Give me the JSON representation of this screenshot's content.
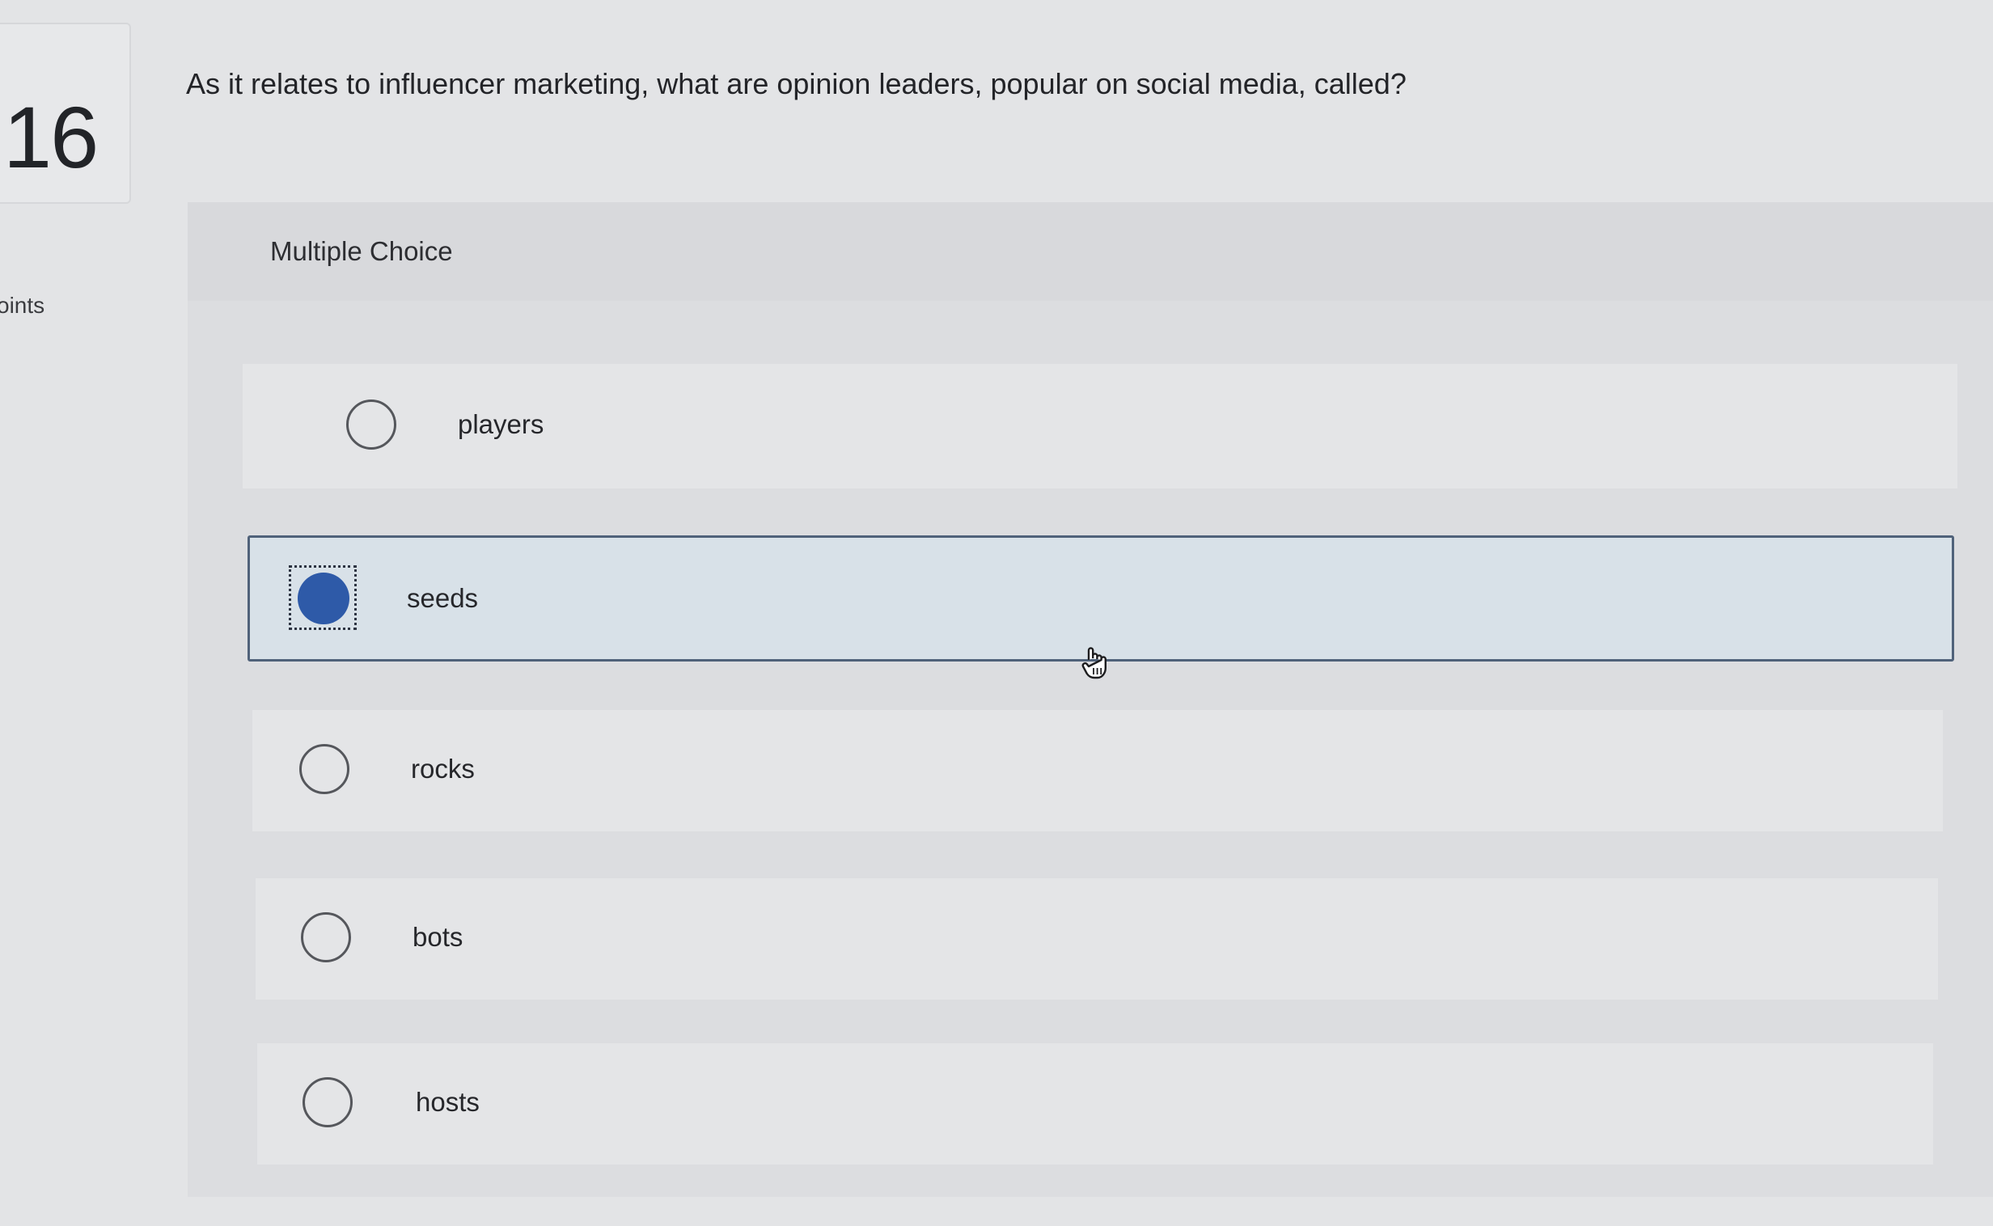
{
  "question": {
    "number": "16",
    "points_label": "oints",
    "text": "As it relates to influencer marketing, what are opinion leaders, popular on social media, called?"
  },
  "choice_panel": {
    "title": "Multiple Choice",
    "options": [
      {
        "label": "players",
        "selected": false
      },
      {
        "label": "seeds",
        "selected": true
      },
      {
        "label": "rocks",
        "selected": false
      },
      {
        "label": "bots",
        "selected": false
      },
      {
        "label": "hosts",
        "selected": false
      }
    ]
  },
  "colors": {
    "selected_fill": "#2e5aa8",
    "selected_background": "#d8e1e8",
    "selected_border": "#50627a"
  },
  "icons": {
    "cursor": "hand-pointer-icon"
  }
}
